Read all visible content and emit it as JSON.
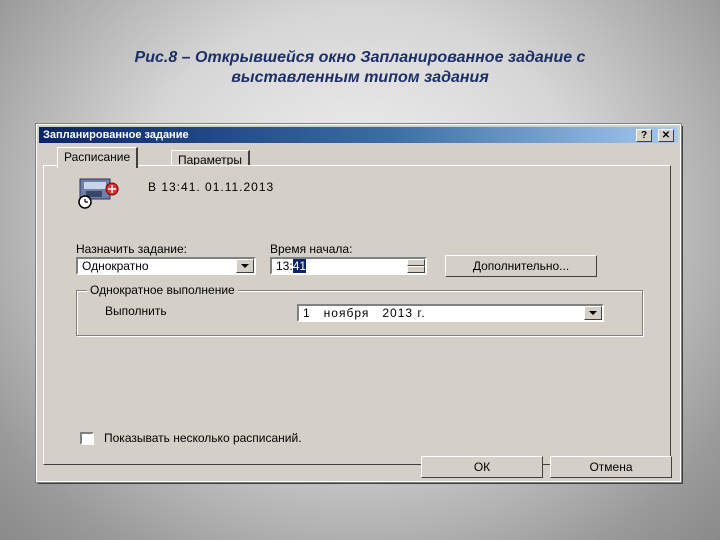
{
  "caption": {
    "line1": "Рис.8 – Открывшейся окно Запланированное задание с",
    "line2": "выставленным типом задания"
  },
  "window": {
    "title": "Запланированное задание",
    "help_button": "?",
    "close_button": "✕"
  },
  "tabs": [
    {
      "label": "Расписание",
      "active": true
    },
    {
      "label": "Параметры",
      "active": false
    }
  ],
  "summary": {
    "text": "В 13:41. 01.11.2013",
    "icon": "scheduled-task-clock-icon"
  },
  "schedule": {
    "label": "Назначить задание:",
    "value": "Однократно"
  },
  "start_time": {
    "label": "Время начала:",
    "hours": "13:",
    "minutes": "41"
  },
  "advanced_button": "Дополнительно...",
  "once_group": {
    "title": "Однократное выполнение",
    "run_label": "Выполнить",
    "date_value": "1   ноября   2013 г."
  },
  "show_multiple": {
    "label": "Показывать несколько расписаний.",
    "checked": false
  },
  "buttons": {
    "ok": "ОК",
    "cancel": "Отмена"
  },
  "colors": {
    "titlebar": "#0a246a",
    "caption": "#1c2f66",
    "face": "#d4d0c8"
  }
}
